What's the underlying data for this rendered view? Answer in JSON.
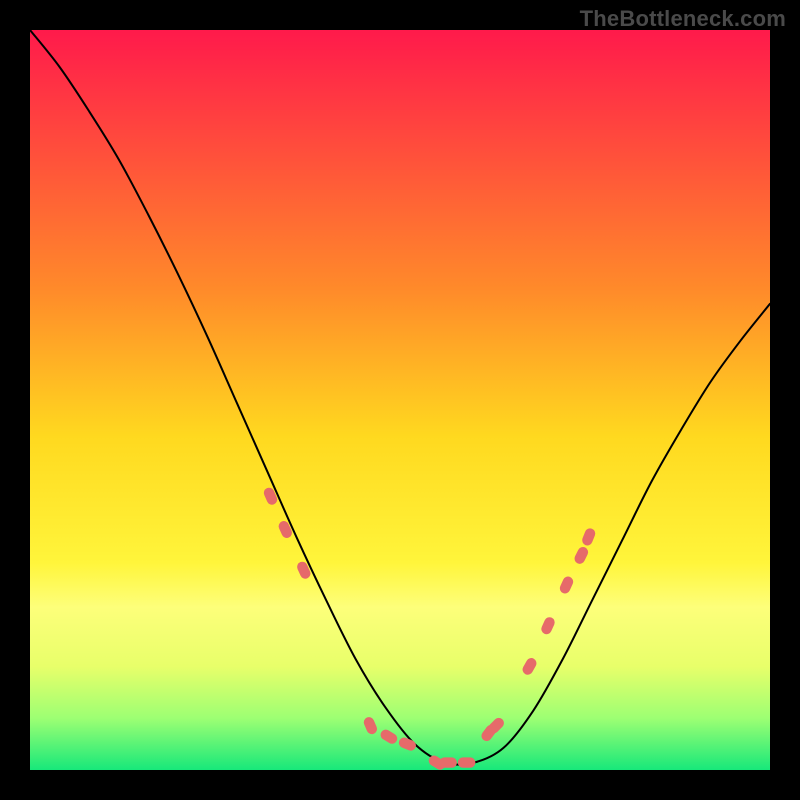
{
  "watermark": {
    "text": "TheBottleneck.com"
  },
  "chart_data": {
    "type": "line",
    "title": "",
    "xlabel": "",
    "ylabel": "",
    "xlim": [
      0,
      100
    ],
    "ylim": [
      0,
      100
    ],
    "grid": false,
    "gradient_stops": [
      {
        "offset": 0,
        "color": "#ff1a4b"
      },
      {
        "offset": 35,
        "color": "#ff8a2a"
      },
      {
        "offset": 55,
        "color": "#ffd91f"
      },
      {
        "offset": 72,
        "color": "#fff53b"
      },
      {
        "offset": 78,
        "color": "#fdff7a"
      },
      {
        "offset": 86,
        "color": "#e8ff6a"
      },
      {
        "offset": 93,
        "color": "#9dff73"
      },
      {
        "offset": 100,
        "color": "#17e87a"
      }
    ],
    "series": [
      {
        "name": "bottleneck-curve",
        "color": "#000000",
        "width": 2,
        "x": [
          0,
          4,
          8,
          12,
          16,
          20,
          24,
          28,
          32,
          36,
          40,
          44,
          48,
          52,
          56,
          60,
          64,
          68,
          72,
          76,
          80,
          84,
          88,
          92,
          96,
          100
        ],
        "y": [
          100,
          95,
          89,
          82.5,
          75,
          67,
          58.5,
          49.5,
          40.5,
          31.5,
          23,
          15,
          8.5,
          3.5,
          1,
          1,
          3,
          8,
          15,
          23,
          31,
          39,
          46,
          52.5,
          58,
          63
        ]
      }
    ],
    "marker_points": {
      "name": "highlight-dots",
      "color": "#e66a6a",
      "radius": 8,
      "shape": "rounded-lozenge",
      "x": [
        32.5,
        34.5,
        37.0,
        46.0,
        48.5,
        51.0,
        55.0,
        56.5,
        59.0,
        62.0,
        63.0,
        67.5,
        70.0,
        72.5,
        74.5,
        75.5
      ],
      "y": [
        37.0,
        32.5,
        27.0,
        6.0,
        4.5,
        3.5,
        1.0,
        1.0,
        1.0,
        5.0,
        6.0,
        14.0,
        19.5,
        25.0,
        29.0,
        31.5
      ]
    }
  }
}
